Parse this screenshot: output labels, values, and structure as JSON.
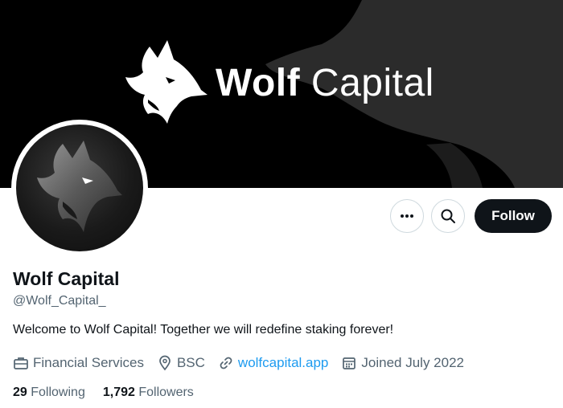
{
  "banner": {
    "title_bold": "Wolf",
    "title_light": "Capital"
  },
  "profile": {
    "display_name": "Wolf Capital",
    "handle": "@Wolf_Capital_",
    "bio": "Welcome to Wolf Capital! Together we will redefine staking forever!",
    "category": "Financial Services",
    "location": "BSC",
    "website": "wolfcapital.app",
    "joined": "Joined July 2022"
  },
  "actions": {
    "more_label": "•••",
    "follow_label": "Follow"
  },
  "stats": {
    "following_count": "29",
    "following_label": "Following",
    "followers_count": "1,792",
    "followers_label": "Followers"
  },
  "icons": {
    "more": "more-icon",
    "search": "search-icon",
    "category": "briefcase-icon",
    "location": "location-pin-icon",
    "website": "link-icon",
    "joined": "calendar-icon"
  },
  "colors": {
    "banner_bg": "#000000",
    "text_primary": "#0f1419",
    "text_secondary": "#536471",
    "link": "#1d9bf0",
    "follow_button_bg": "#0f1419"
  }
}
